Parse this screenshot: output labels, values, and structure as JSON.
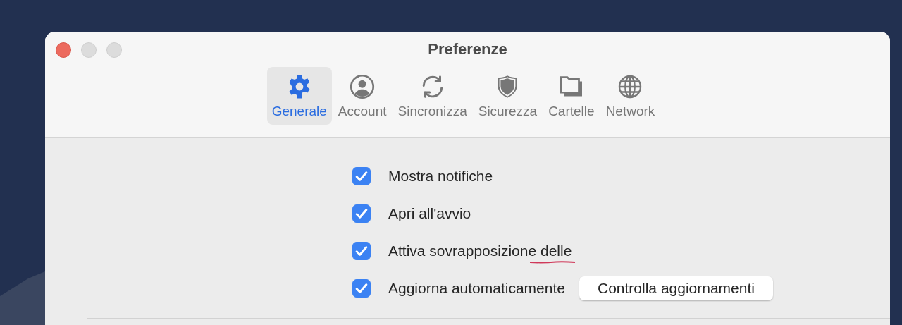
{
  "window": {
    "title": "Preferenze"
  },
  "tabs": [
    {
      "label": "Generale",
      "selected": true
    },
    {
      "label": "Account",
      "selected": false
    },
    {
      "label": "Sincronizza",
      "selected": false
    },
    {
      "label": "Sicurezza",
      "selected": false
    },
    {
      "label": "Cartelle",
      "selected": false
    },
    {
      "label": "Network",
      "selected": false
    }
  ],
  "options": [
    {
      "label": "Mostra notifiche",
      "checked": true
    },
    {
      "label": "Apri all'avvio",
      "checked": true
    },
    {
      "label": "Attiva sovrapposizione delle",
      "checked": true,
      "misspelled": true
    },
    {
      "label": "Aggiorna automaticamente",
      "checked": true,
      "button": "Controlla aggiornamenti"
    }
  ]
}
